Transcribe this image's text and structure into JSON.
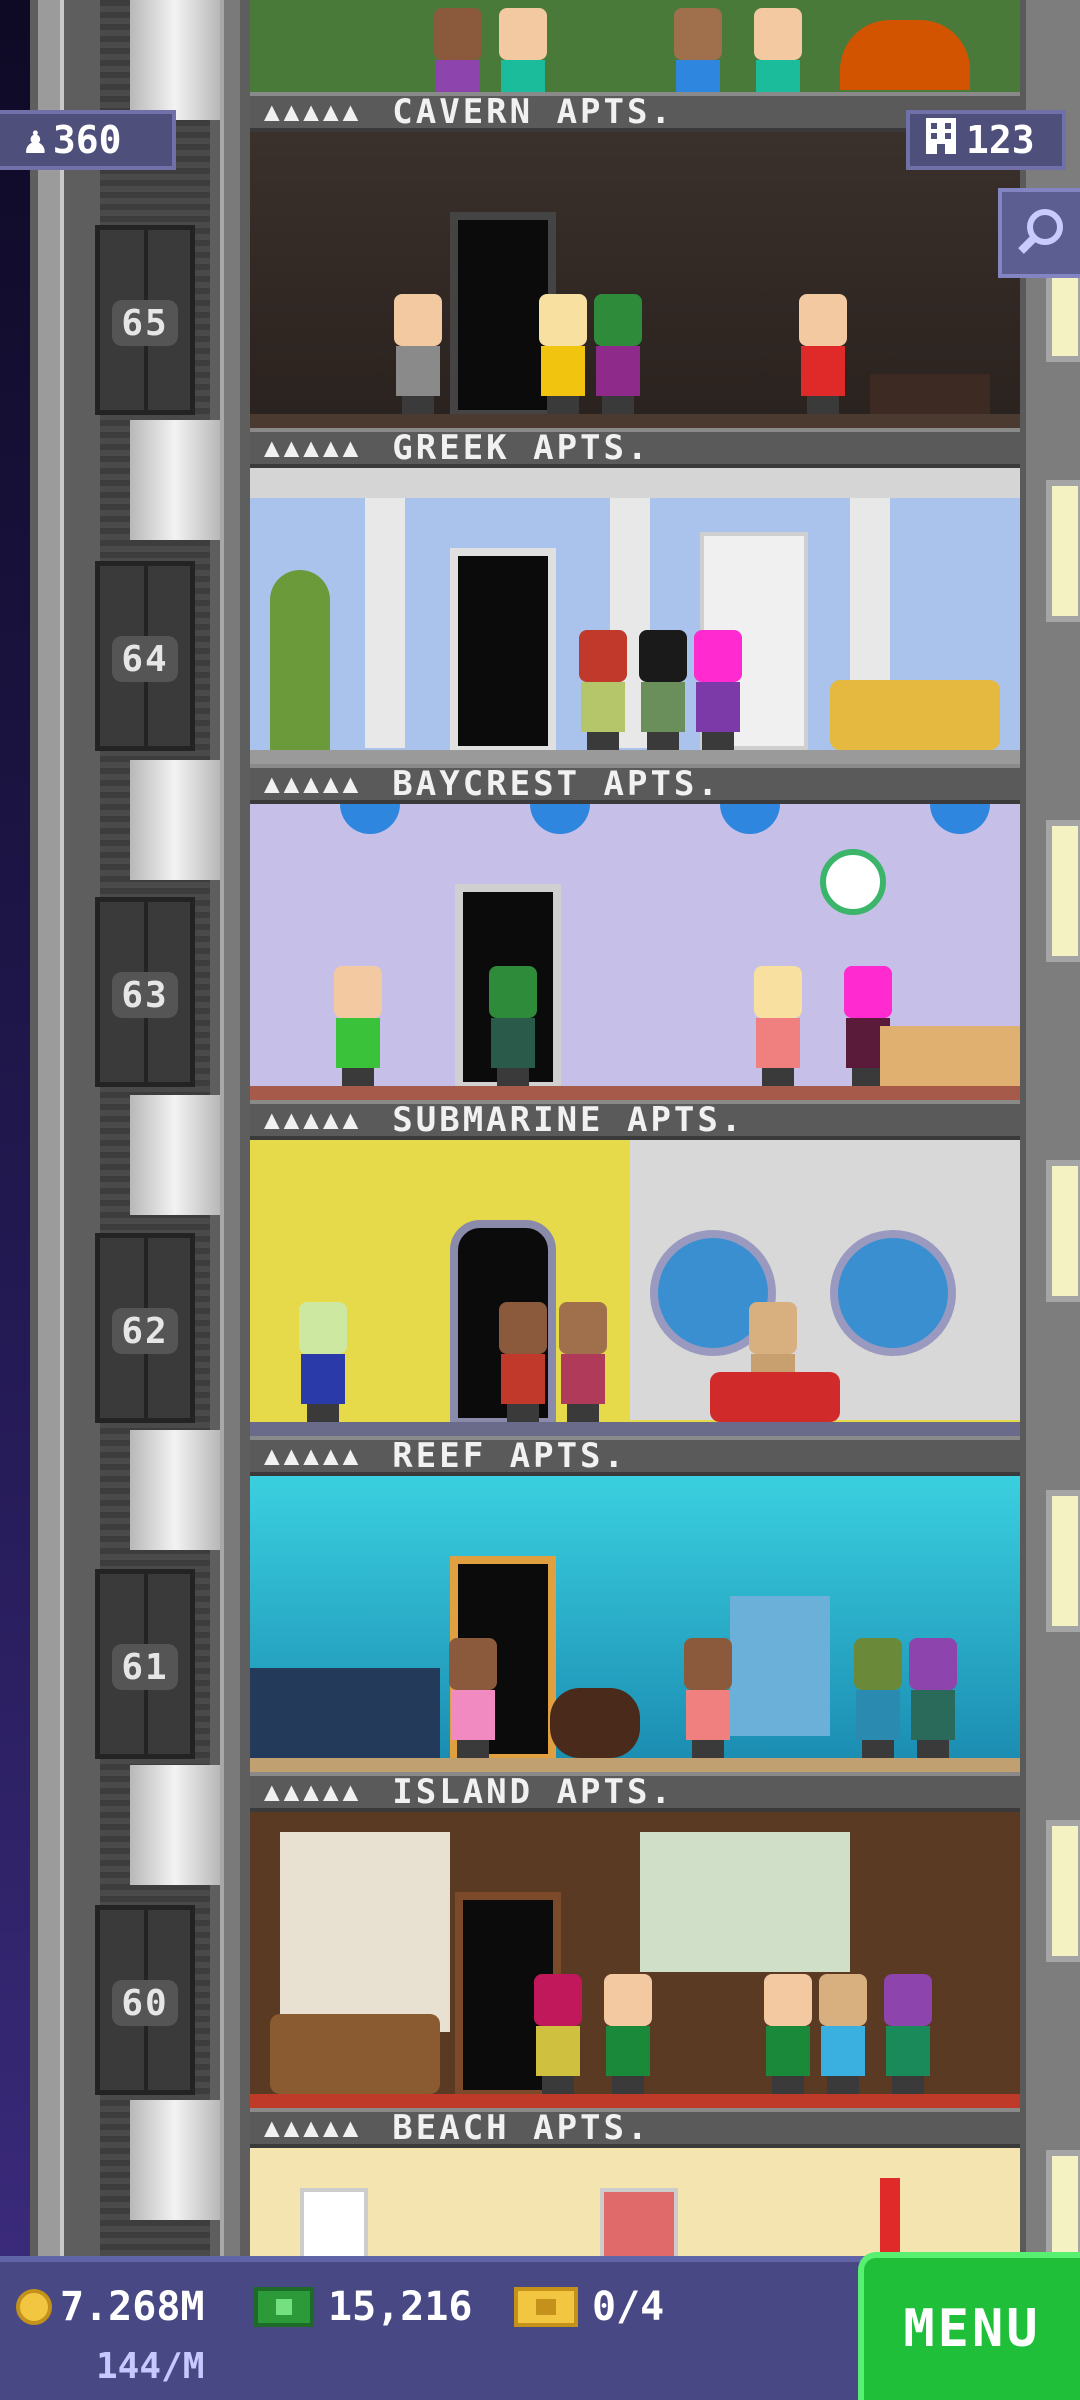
{
  "hud_top": {
    "population": "360",
    "floor_count": "123"
  },
  "floors": [
    {
      "number": "65",
      "name": "CAVERN APTS."
    },
    {
      "number": "64",
      "name": "GREEK APTS."
    },
    {
      "number": "63",
      "name": "BAYCREST APTS."
    },
    {
      "number": "62",
      "name": "SUBMARINE APTS."
    },
    {
      "number": "61",
      "name": "REEF APTS."
    },
    {
      "number": "60",
      "name": "ISLAND APTS."
    },
    {
      "number": "",
      "name": "BEACH APTS."
    }
  ],
  "occupancy_dots": "▲▲▲▲▲",
  "hud_bottom": {
    "coins": "7.268M",
    "coin_rate": "144/M",
    "tower_bux": "15,216",
    "tickets": "0/4",
    "menu_label": "MENU"
  },
  "colors": {
    "hud_bg": "#474884",
    "menu_green": "#1fbf3a"
  },
  "icons": [
    "person-icon",
    "building-icon",
    "search-icon",
    "coin-icon",
    "bux-icon",
    "ticket-icon"
  ]
}
